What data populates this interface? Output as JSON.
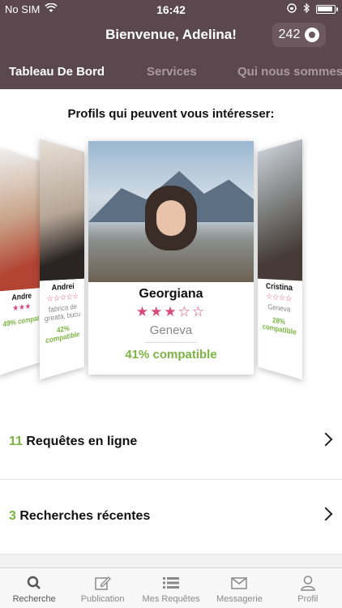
{
  "status": {
    "carrier": "No SIM",
    "time": "16:42"
  },
  "header": {
    "title": "Bienvenue, Adelina!",
    "coins": "242"
  },
  "tabs": [
    {
      "label": "Tableau De Bord",
      "active": true
    },
    {
      "label": "Services",
      "active": false
    },
    {
      "label": "Qui nous sommes",
      "active": false
    }
  ],
  "profiles": {
    "heading": "Profils qui peuvent vous intéresser:",
    "cards": [
      {
        "name": "Andre",
        "stars": "★★★",
        "city": "",
        "compat": "49% compat"
      },
      {
        "name": "Andrei",
        "stars": "☆☆☆☆☆",
        "city": "fabrica de greata, bucu",
        "compat": "42% compatible"
      },
      {
        "name": "Georgiana",
        "stars": "★★★☆☆",
        "city": "Geneva",
        "compat": "41% compatible"
      },
      {
        "name": "Cristina",
        "stars": "☆☆☆☆",
        "city": "Geneva",
        "compat": "28% compatible"
      }
    ]
  },
  "rows": [
    {
      "count": "11",
      "label": " Requêtes en ligne"
    },
    {
      "count": "3",
      "label": " Recherches récentes"
    }
  ],
  "tabbar": [
    {
      "label": "Recherche",
      "icon": "search-icon"
    },
    {
      "label": "Publication",
      "icon": "edit-icon"
    },
    {
      "label": "Mes Requêtes",
      "icon": "list-icon"
    },
    {
      "label": "Messagerie",
      "icon": "mail-icon"
    },
    {
      "label": "Profil",
      "icon": "user-icon"
    }
  ]
}
